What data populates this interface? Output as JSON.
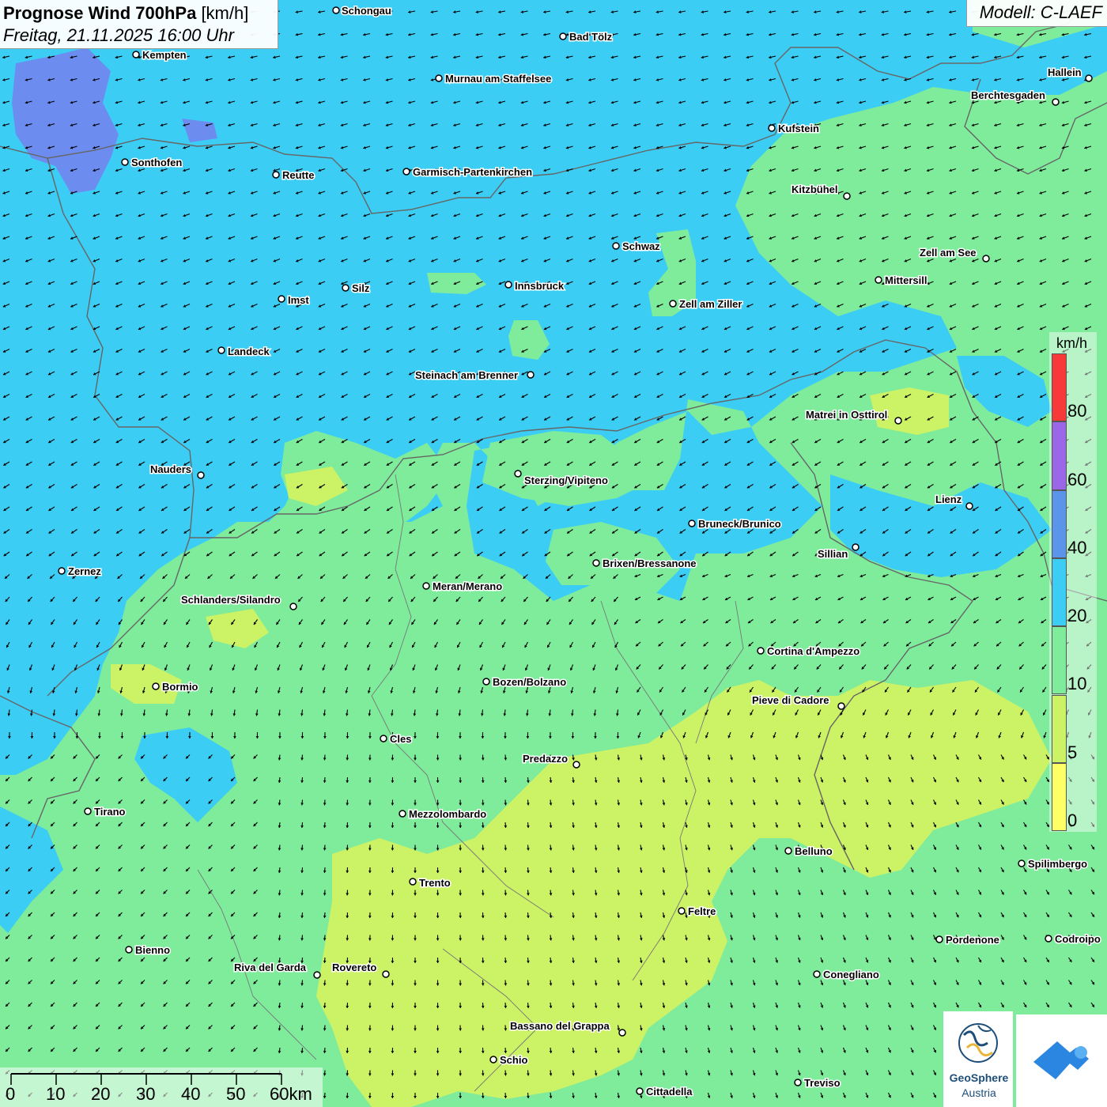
{
  "header": {
    "title_bold": "Prognose Wind 700hPa",
    "title_unit": "[km/h]",
    "subtitle": "Freitag, 21.11.2025 16:00 Uhr",
    "model": "Modell: C-LAEF"
  },
  "legend": {
    "unit": "km/h",
    "bins": [
      {
        "from": 0,
        "to": 5,
        "color": "#ffff66"
      },
      {
        "from": 5,
        "to": 10,
        "color": "#ccf266"
      },
      {
        "from": 10,
        "to": 20,
        "color": "#7fec9c"
      },
      {
        "from": 20,
        "to": 40,
        "color": "#3ccdf5"
      },
      {
        "from": 40,
        "to": 60,
        "color": "#5b95ea"
      },
      {
        "from": 60,
        "to": 80,
        "color": "#9c66e8"
      },
      {
        "from": 80,
        "to": null,
        "color": "#f73939"
      }
    ],
    "ticks": [
      "80",
      "60",
      "40",
      "20",
      "10",
      "5",
      "0"
    ]
  },
  "scale_bar": {
    "labels": [
      "0",
      "10",
      "20",
      "30",
      "40",
      "50",
      "60km"
    ]
  },
  "logos": {
    "geosphere_line1": "GeoSphere",
    "geosphere_line2": "Austria",
    "geosphere_icon": "geosphere-logo-icon",
    "second_icon": "cloud-roof-logo-icon"
  },
  "cities": [
    {
      "name": "Schongau"
    },
    {
      "name": "Bad Tölz"
    },
    {
      "name": "Kempten"
    },
    {
      "name": "Murnau am Staffelsee"
    },
    {
      "name": "Hallein"
    },
    {
      "name": "Berchtesgaden"
    },
    {
      "name": "Kufstein"
    },
    {
      "name": "Sonthofen"
    },
    {
      "name": "Reutte"
    },
    {
      "name": "Garmisch-Partenkirchen"
    },
    {
      "name": "Kitzbühel"
    },
    {
      "name": "Schwaz"
    },
    {
      "name": "Zell am See"
    },
    {
      "name": "Mittersill"
    },
    {
      "name": "Innsbruck"
    },
    {
      "name": "Silz"
    },
    {
      "name": "Imst"
    },
    {
      "name": "Zell am Ziller"
    },
    {
      "name": "Landeck"
    },
    {
      "name": "Steinach am Brenner"
    },
    {
      "name": "Matrei in Osttirol"
    },
    {
      "name": "Nauders"
    },
    {
      "name": "Sterzing/Vipiteno"
    },
    {
      "name": "Lienz"
    },
    {
      "name": "Bruneck/Brunico"
    },
    {
      "name": "Sillian"
    },
    {
      "name": "Brixen/Bressanone"
    },
    {
      "name": "Zernez"
    },
    {
      "name": "Meran/Merano"
    },
    {
      "name": "Schlanders/Silandro"
    },
    {
      "name": "Cortina d'Ampezzo"
    },
    {
      "name": "Bozen/Bolzano"
    },
    {
      "name": "Bormio"
    },
    {
      "name": "Pieve di Cadore"
    },
    {
      "name": "Cles"
    },
    {
      "name": "Predazzo"
    },
    {
      "name": "Tirano"
    },
    {
      "name": "Mezzolombardo"
    },
    {
      "name": "Belluno"
    },
    {
      "name": "Spilimbergo"
    },
    {
      "name": "Trento"
    },
    {
      "name": "Feltre"
    },
    {
      "name": "Pordenone"
    },
    {
      "name": "Codroipo"
    },
    {
      "name": "Bienno"
    },
    {
      "name": "Riva del Garda"
    },
    {
      "name": "Rovereto"
    },
    {
      "name": "Conegliano"
    },
    {
      "name": "Bassano del Grappa"
    },
    {
      "name": "Schio"
    },
    {
      "name": "Treviso"
    },
    {
      "name": "Cittadella"
    }
  ]
}
